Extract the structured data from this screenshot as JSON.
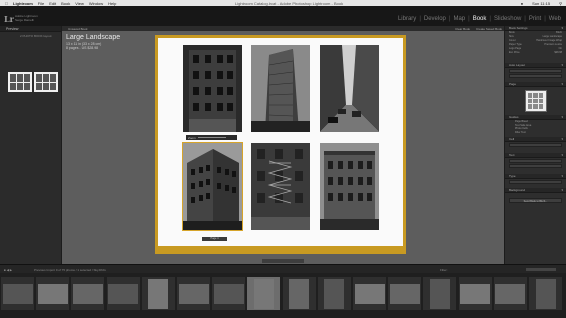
{
  "menubar": {
    "apple": "",
    "items": [
      "Lightroom",
      "File",
      "Edit",
      "Book",
      "View",
      "Window",
      "Help"
    ],
    "window_title": "Lightroom Catalog.lrcat - Adobe Photoshop Lightroom - Book",
    "status": "Sun 11:15"
  },
  "topbar": {
    "logo": "Lr",
    "identity_line1": "Adobe Lightroom",
    "identity_line2": "Serge Ramelli",
    "modules": [
      "Library",
      "Develop",
      "Map",
      "Book",
      "Slideshow",
      "Print",
      "Web"
    ],
    "active_module": "Book"
  },
  "left_panel": {
    "header": "Preview",
    "preset": "2 PHOTO BOOK layout"
  },
  "main": {
    "toolbar_label": "Unsaved Book",
    "toolbar_buttons": [
      "Clear Book",
      "Create Saved Book"
    ],
    "book_title": "Large Landscape",
    "book_dims": "13 x 11 in (33 x 28 cm)",
    "book_pages": "8 pages - US $28.98",
    "photo_toolbar": "Zoom",
    "page_label": "Page 4"
  },
  "right_panel": {
    "header": "Book Settings",
    "rows": [
      {
        "label": "Book",
        "value": "Blurb"
      },
      {
        "label": "Size",
        "value": "Large Landscape"
      },
      {
        "label": "Cover",
        "value": "Hardcover Image Wrap"
      },
      {
        "label": "Paper Type",
        "value": "Premium Lustre"
      },
      {
        "label": "Logo Page",
        "value": "On"
      },
      {
        "label": "Est. Price",
        "value": "$28.98"
      }
    ],
    "autolayout_header": "Auto Layout",
    "page_header": "Page",
    "guides_header": "Guides",
    "guides_checks": [
      "Page Bleed",
      "Text Safe Area",
      "Photo Cells",
      "Filler Text"
    ],
    "cell_header": "Cell",
    "text_header": "Text",
    "type_header": "Type",
    "background_header": "Background",
    "send_button": "Send Book to Blurb..."
  },
  "filmstrip": {
    "info": "Previous Import  9 of 75 photos / 1 selected / Sky.DNG",
    "filter_label": "Filter:",
    "thumb_count": 16,
    "selected_index": 7
  }
}
